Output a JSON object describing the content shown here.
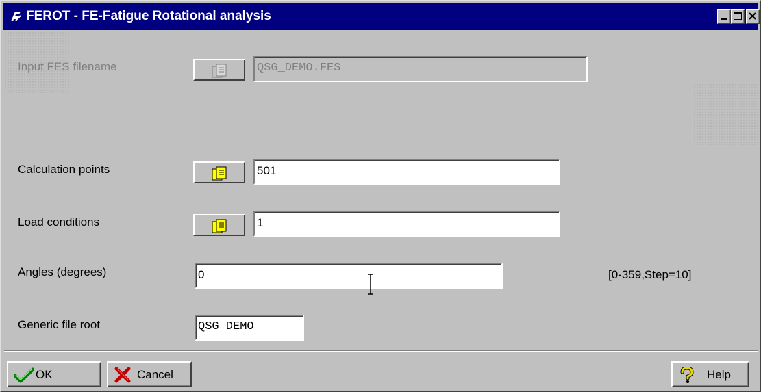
{
  "window": {
    "title": "FEROT - FE-Fatigue Rotational analysis",
    "title_bar_color": "#000080",
    "icons": {
      "app": "fe-fatigue-app-icon",
      "minimize": "minimize-icon",
      "maximize": "maximize-icon",
      "close": "close-icon"
    }
  },
  "form": {
    "input_fes": {
      "label": "Input FES filename",
      "value": "QSG_DEMO.FES",
      "enabled": false,
      "browse_icon": "file-browse-icon"
    },
    "calc_points": {
      "label": "Calculation points",
      "value": "501",
      "browse_icon": "file-browse-icon"
    },
    "load_conditions": {
      "label": "Load conditions",
      "value": "1",
      "browse_icon": "file-browse-icon"
    },
    "angles": {
      "label": "Angles (degrees)",
      "value": "0",
      "hint": "[0-359,Step=10]"
    },
    "generic_root": {
      "label": "Generic file root",
      "value": "QSG_DEMO"
    }
  },
  "buttons": {
    "ok": {
      "label": "OK",
      "icon": "checkmark-icon"
    },
    "cancel": {
      "label": "Cancel",
      "icon": "cancel-x-icon"
    },
    "help": {
      "label": "Help",
      "icon": "question-mark-icon"
    }
  },
  "colors": {
    "background": "#c0c0c0",
    "field": "#ffffff",
    "disabled_text": "#808080",
    "icon_yellow": "#ffff00",
    "ok_green": "#008000",
    "cancel_red": "#c00000"
  }
}
